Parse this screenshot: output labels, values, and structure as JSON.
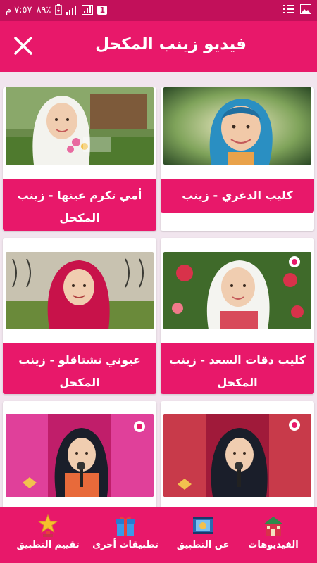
{
  "status_bar": {
    "time": "٧:٥٧ م",
    "battery": "٨٩٪",
    "sim_badge": "1"
  },
  "app_bar": {
    "title": "فيديو زينب المكحل",
    "close_icon": "close-icon"
  },
  "videos": [
    {
      "caption": "كليب الدغري - زينب المكحل",
      "thumb": "girl-blue-hijab"
    },
    {
      "caption": "أمي تكرم عينها - زينب المكحل",
      "thumb": "girl-white-hijab-garden"
    },
    {
      "caption": "كليب دقات السعد - زينب المكحل",
      "thumb": "girl-white-hijab-flowers"
    },
    {
      "caption": "عيوني تشتاقلو - زينب المكحل",
      "thumb": "girl-red-hijab"
    },
    {
      "caption": "",
      "thumb": "girl-singing-stage-dark"
    },
    {
      "caption": "",
      "thumb": "girl-singing-stage-pink"
    }
  ],
  "bottom_nav": [
    {
      "label": "الفيديوهات",
      "icon": "house-icon"
    },
    {
      "label": "عن التطبيق",
      "icon": "film-icon"
    },
    {
      "label": "تطبيقات أخرى",
      "icon": "gift-icon"
    },
    {
      "label": "تقييم التطبيق",
      "icon": "star-trophy-icon"
    }
  ],
  "colors": {
    "primary": "#e8186a",
    "status_bar": "#c2105a",
    "background": "#f1e5ee"
  }
}
